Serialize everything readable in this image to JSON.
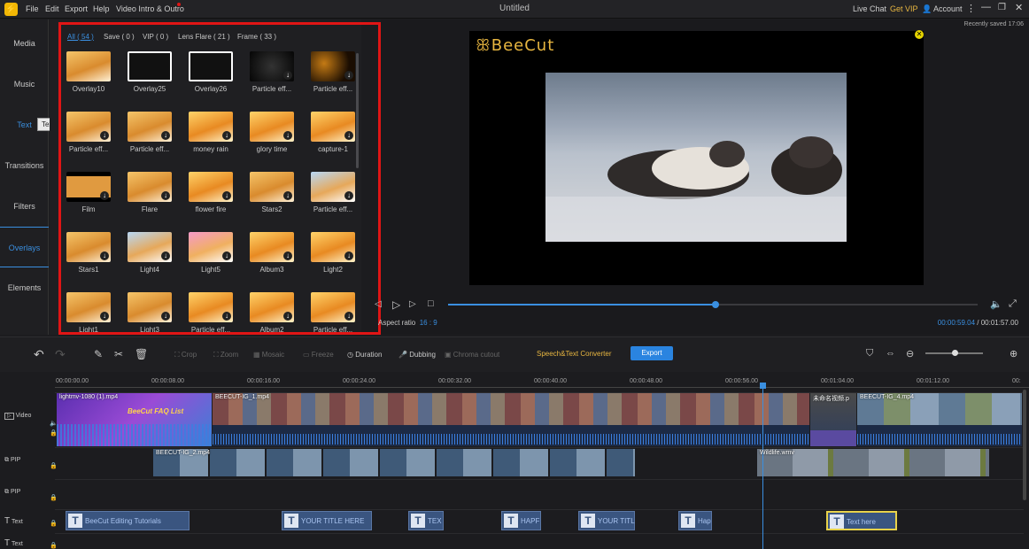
{
  "menu": {
    "file": "File",
    "edit": "Edit",
    "export": "Export",
    "help": "Help",
    "intro": "Video Intro & Outro"
  },
  "app_title": "Untitled",
  "titlebar_right": {
    "live_chat": "Live Chat",
    "get_vip": "Get VIP",
    "account": "Account"
  },
  "recently_saved": "Recently saved 17:06",
  "nav": [
    "Media",
    "Music",
    "Text",
    "Transitions",
    "Filters",
    "Overlays",
    "Elements"
  ],
  "nav_active": "Overlays",
  "tooltip": "Text",
  "filter_tabs": [
    "All ( 54 )",
    "Save ( 0 )",
    "VIP ( 0 )",
    "Lens Flare ( 21 )",
    "Frame ( 33 )"
  ],
  "overlays": [
    [
      "Overlay10",
      "Overlay25",
      "Overlay26",
      "Particle eff...",
      "Particle eff..."
    ],
    [
      "Particle eff...",
      "Particle eff...",
      "money rain",
      "glory time",
      "capture-1"
    ],
    [
      "Film",
      "Flare",
      "flower fire",
      "Stars2",
      "Particle eff..."
    ],
    [
      "Stars1",
      "Light4",
      "Light5",
      "Album3",
      "Light2"
    ],
    [
      "Light1",
      "Light3",
      "Particle eff...",
      "Album2",
      "Particle eff..."
    ]
  ],
  "preview": {
    "brand": "BeeCut"
  },
  "aspect_label": "Aspect ratio",
  "aspect_value": "16 : 9",
  "time_current": "00:00:59.04",
  "time_sep": "/",
  "time_total": "00:01:57.00",
  "progress_fraction": 0.505,
  "tools": {
    "crop": "Crop",
    "zoom": "Zoom",
    "mosaic": "Mosaic",
    "freeze": "Freeze",
    "duration": "Duration",
    "dubbing": "Dubbing",
    "chroma": "Chroma cutout"
  },
  "converter": "Speech&Text Converter",
  "export_button": "Export",
  "ruler": [
    "00:00:00.00",
    "00:00:08.00",
    "00:00:16.00",
    "00:00:24.00",
    "00:00:32.00",
    "00:00:40.00",
    "00:00:48.00",
    "00:00:56.00",
    "00:01:04.00",
    "00:01:12.00",
    "00:"
  ],
  "tracks": {
    "video": "Video",
    "pip1": "PIP",
    "pip2": "PIP",
    "text1": "Text",
    "text2": "Text"
  },
  "video_clips": [
    "lightmv-1080 (1).mp4",
    "BEECUT-IG_1.mp4",
    "未命名视频.p",
    "BEECUT-IG_4.mp4"
  ],
  "pip_clips": [
    "BEECUT-IG_2.mp4",
    "Wildlife.wmv"
  ],
  "intro_clip_text": "BeeCut FAQ List",
  "text_clips": [
    "BeeCut Editing Tutorials",
    "YOUR TITLE HERE",
    "TEX",
    "HAPF",
    "YOUR TITL",
    "Hap",
    "Text here"
  ],
  "colors": {
    "accent": "#3a8fe0",
    "brand": "#e8b640",
    "highlight": "#e01515"
  }
}
